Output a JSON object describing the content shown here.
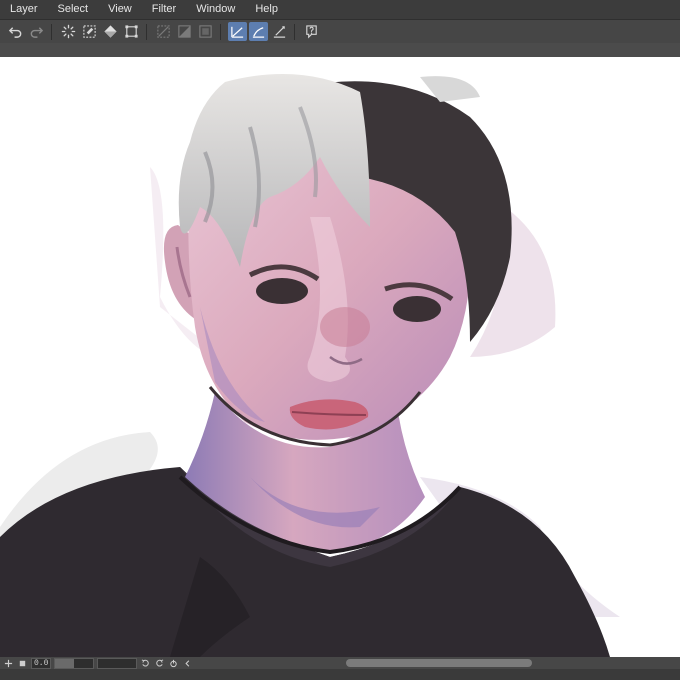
{
  "menubar": {
    "items": [
      "Layer",
      "Select",
      "View",
      "Filter",
      "Window",
      "Help"
    ]
  },
  "toolbar": {
    "tools": [
      {
        "icon": "undo-icon"
      },
      {
        "icon": "redo-icon"
      },
      {
        "icon": "busy-spinner-icon"
      },
      {
        "icon": "clear-layer-icon"
      },
      {
        "icon": "fill-icon"
      },
      {
        "icon": "transform-icon"
      },
      {
        "icon": "selection-outside-icon"
      },
      {
        "icon": "selection-fill-icon"
      },
      {
        "icon": "selection-frame-icon"
      },
      {
        "icon": "snap-ruler-icon"
      },
      {
        "icon": "snap-special-ruler-icon"
      },
      {
        "icon": "snap-grid-icon"
      },
      {
        "icon": "help-icon"
      }
    ]
  },
  "statusbar": {
    "coord_value": "0.0",
    "zoom_fraction": 0.5
  },
  "colors": {
    "menubar": "#3c3c3c",
    "toolbar": "#464646",
    "active_tool": "#5d7eb0",
    "canvas": "#ffffff"
  },
  "canvas": {
    "content": "digital painting of a young man with two-tone silver and black hair wearing a dark top"
  }
}
